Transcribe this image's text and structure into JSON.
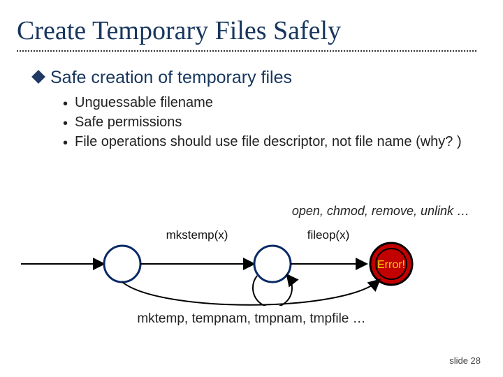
{
  "title": "Create Temporary Files Safely",
  "main_point": "Safe creation of temporary files",
  "bullets": [
    "Unguessable filename",
    "Safe permissions",
    "File operations should use file descriptor, not file name (why? )"
  ],
  "annotation": "open, chmod, remove, unlink …",
  "edge1": "mkstemp(x)",
  "edge2": "fileop(x)",
  "error_label": "Error!",
  "bottom_fns": "mktemp, tempnam, tmpnam, tmpfile …",
  "slide_number": "slide 28"
}
